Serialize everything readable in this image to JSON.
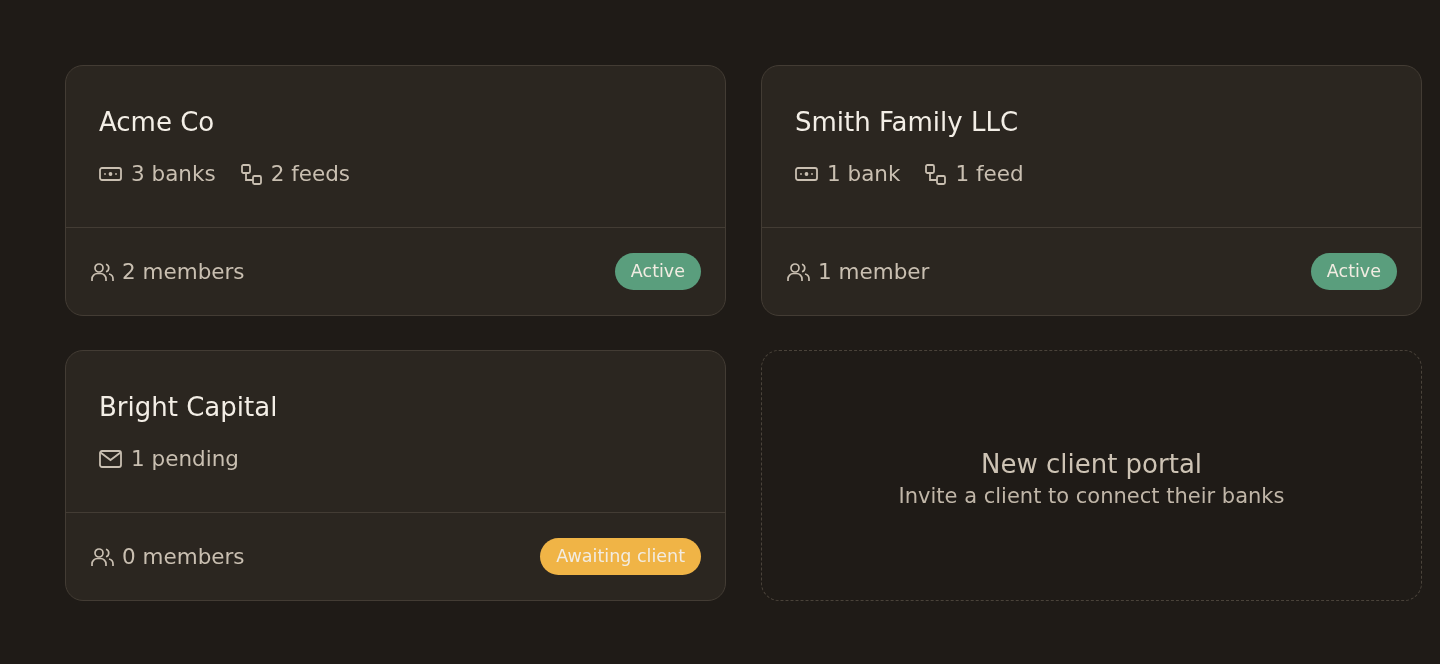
{
  "clients": [
    {
      "name": "Acme Co",
      "stats": [
        {
          "kind": "bank",
          "text": "3 banks"
        },
        {
          "kind": "feed",
          "text": "2 feeds"
        }
      ],
      "members": "2 members",
      "status": {
        "label": "Active",
        "color": "#5a9e7d"
      }
    },
    {
      "name": "Smith Family LLC",
      "stats": [
        {
          "kind": "bank",
          "text": "1 bank"
        },
        {
          "kind": "feed",
          "text": "1 feed"
        }
      ],
      "members": "1 member",
      "status": {
        "label": "Active",
        "color": "#5a9e7d"
      }
    },
    {
      "name": "Bright Capital",
      "stats": [
        {
          "kind": "pending",
          "text": "1 pending"
        }
      ],
      "members": "0 members",
      "status": {
        "label": "Awaiting client",
        "color": "#f0b446"
      }
    }
  ],
  "new_portal": {
    "title": "New client portal",
    "subtitle": "Invite a client to connect their banks"
  }
}
